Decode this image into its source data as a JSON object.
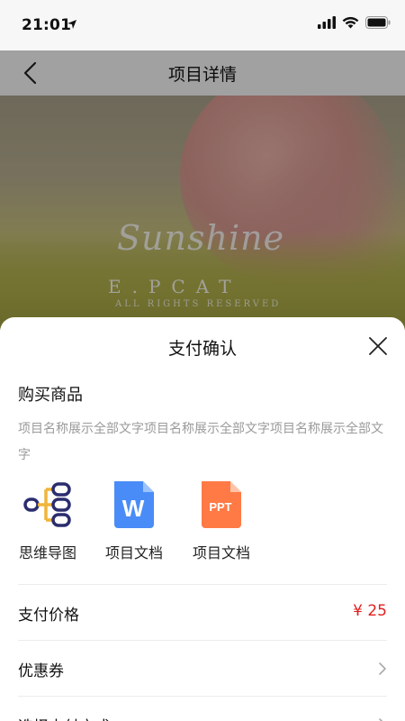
{
  "status_bar": {
    "time": "21:01"
  },
  "nav": {
    "title": "项目详情"
  },
  "banner": {
    "script_text": "Sunshine",
    "brand_text": "E.PCAT",
    "rights_text": "ALL RIGHTS RESERVED"
  },
  "sheet": {
    "title": "支付确认",
    "section_title": "购买商品",
    "product_name": "项目名称展示全部文字项目名称展示全部文字项目名称展示全部文字",
    "files": [
      {
        "label": "思维导图",
        "icon": "mind-map-icon"
      },
      {
        "label": "项目文档",
        "icon": "word-doc-icon",
        "icon_text": "W"
      },
      {
        "label": "项目文档",
        "icon": "ppt-doc-icon",
        "icon_text": "PPT"
      }
    ],
    "rows": [
      {
        "label": "支付价格",
        "value": "¥ 25"
      },
      {
        "label": "优惠券"
      },
      {
        "label": "选择支付方式"
      }
    ]
  },
  "colors": {
    "price": "#e02020",
    "ppt": "#ff7a45",
    "word": "#4a8cf7",
    "mindmap": "#2b2d6e",
    "mindmap_accent": "#f0b43c"
  }
}
